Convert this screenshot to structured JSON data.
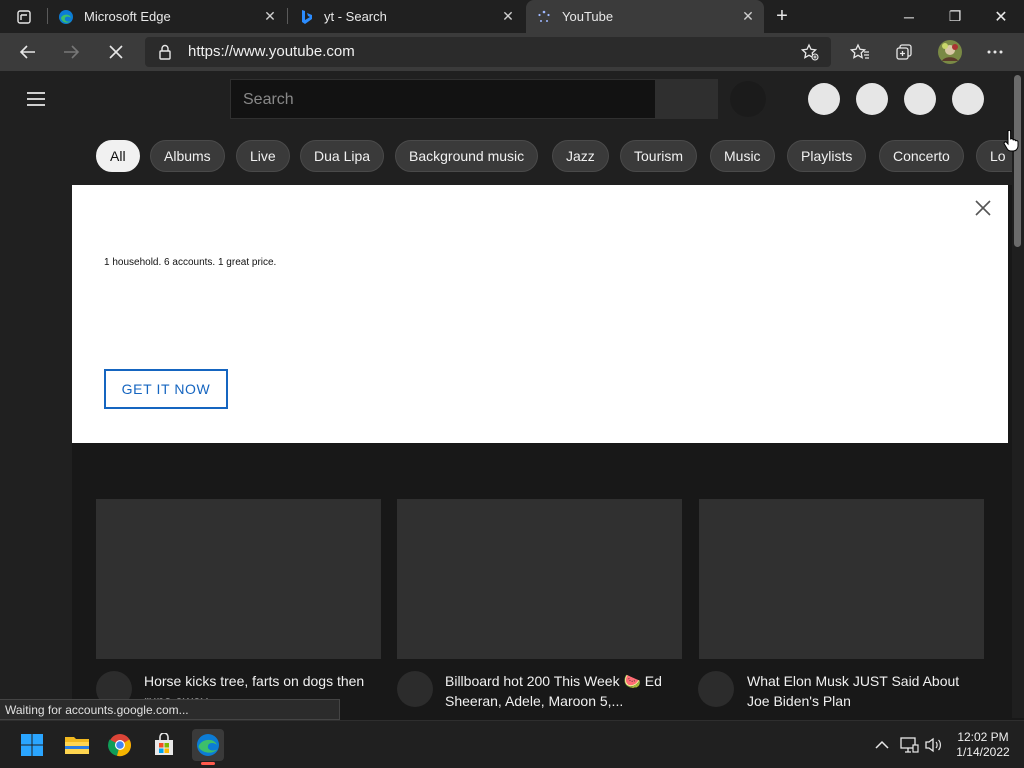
{
  "browser": {
    "tabs": [
      {
        "title": "Microsoft Edge",
        "close": "✕"
      },
      {
        "title": "yt - Search",
        "close": "✕"
      },
      {
        "title": "YouTube",
        "close": "✕"
      }
    ],
    "new_tab": "+",
    "address": "https://www.youtube.com",
    "icons": [
      "tab-actions-icon",
      "back-icon",
      "forward-icon",
      "stop-loading-icon",
      "lock-icon",
      "add-favorite-icon",
      "favorites-icon",
      "collections-icon",
      "profile-avatar",
      "more-icon"
    ]
  },
  "window_controls": {
    "minimize": "─",
    "restore": "❐",
    "close": "✕"
  },
  "youtube": {
    "search_placeholder": "Search",
    "chips": [
      "All",
      "Albums",
      "Live",
      "Dua Lipa",
      "Background music",
      "Jazz",
      "Tourism",
      "Music",
      "Playlists",
      "Concerto",
      "Lo"
    ],
    "active_chip": "All",
    "banner": {
      "text": "1 household. 6 accounts. 1 great price.",
      "cta": "GET IT NOW"
    },
    "videos": [
      {
        "title": "Horse kicks tree, farts on dogs then runs away"
      },
      {
        "title": "Billboard hot 200 This Week 🍉 Ed Sheeran, Adele, Maroon 5,..."
      },
      {
        "title": "What Elon Musk JUST Said About Joe Biden's Plan"
      }
    ]
  },
  "status_text": "Waiting for accounts.google.com...",
  "taskbar": {
    "apps": [
      "start-icon",
      "file-explorer-icon",
      "chrome-icon",
      "store-icon",
      "edge-icon"
    ],
    "tray_caret": "^",
    "time": "12:02 PM",
    "date": "1/14/2022"
  },
  "colors": {
    "edge_blue": "#0c7cd5",
    "edge_green": "#3dbf6b",
    "cta_blue": "#1565c0"
  }
}
